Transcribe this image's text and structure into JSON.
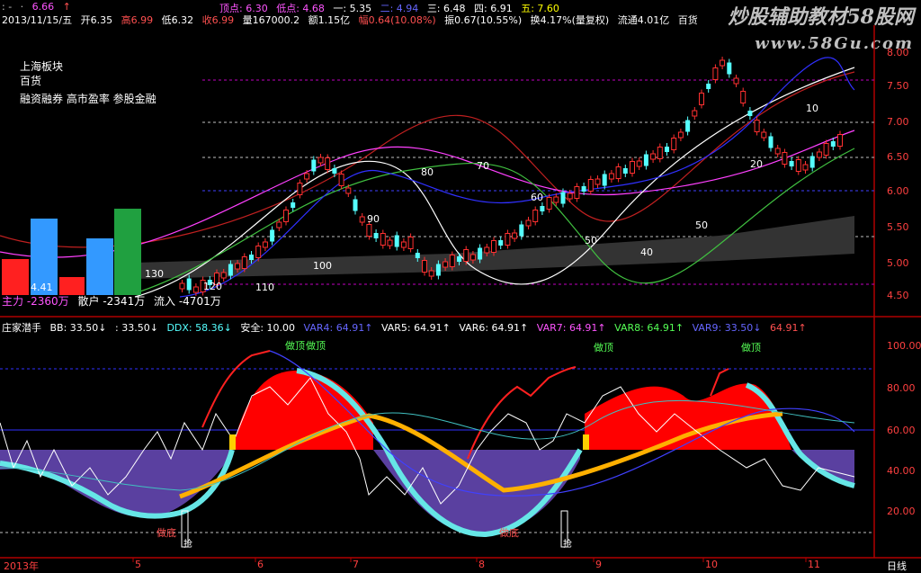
{
  "top_bar": {
    "row1_value": "6.66",
    "row1_arrow": "↑"
  },
  "quote": {
    "date": "2013/11/15/五",
    "open": "开6.35",
    "high": "高6.99",
    "low": "低6.32",
    "close": "收6.99",
    "volume": "量167000.2",
    "amount": "额1.15亿",
    "change": "幅0.64(10.08%)",
    "amplitude": "振0.67(10.55%)",
    "turnover": "换4.17%(量复权)",
    "float": "流通4.01亿",
    "sector": "百货"
  },
  "levels": {
    "top": "顶点: 6.30",
    "bottom": "低点: 4.68",
    "l1": "一: 5.35",
    "l2": "二: 4.94",
    "l3": "三: 6.48",
    "l4": "四: 6.91",
    "l5": "五: 7.60"
  },
  "watermark": {
    "title": "炒股辅助教材58股网",
    "url": "www.58Gu.com"
  },
  "info_panel": {
    "line1": "上海板块",
    "line2": "百货",
    "line3": "融资融券 高市盈率 参股金融"
  },
  "price_axis": [
    "7.50",
    "7.00",
    "6.50",
    "6.00",
    "5.50",
    "5.00",
    "4.50"
  ],
  "price_axis_extra": "8.00",
  "chart_labels": {
    "l130": "130",
    "l120": "120",
    "l110": "110",
    "l100": "100",
    "l90": "90",
    "l80": "80",
    "l70": "70",
    "l60": "60",
    "l50a": "50",
    "l50b": "50",
    "l40": "40",
    "l20": "20",
    "l10": "10",
    "l410": "4.41"
  },
  "flow": {
    "main": "主力 -2360万",
    "retail": "散户 -2341万",
    "inflow": "流入 -4701万"
  },
  "indicator_bar": {
    "name": "庄家潜手",
    "bb": "BB: 33.50↓",
    "bb2": ": 33.50↓",
    "ddx": "DDX: 58.36↓",
    "safe": "安全: 10.00",
    "var4": "VAR4: 64.91↑",
    "var5": "VAR5: 64.91↑",
    "var6": "VAR6: 64.91↑",
    "var7": "VAR7: 64.91↑",
    "var8": "VAR8: 64.91↑",
    "var9": "VAR9: 33.50↓",
    "last": "64.91↑"
  },
  "indicator_axis": [
    "100.00",
    "80.00",
    "60.00",
    "40.00",
    "20.00"
  ],
  "signals": {
    "top1": "做顶",
    "top2": "做顶",
    "top3": "做顶",
    "top4": "做顶",
    "bottom1": "做底",
    "bottom2": "做底",
    "check1": "抢",
    "check2": "抢"
  },
  "time_axis": {
    "year": "2013年",
    "m5": "5",
    "m6": "6",
    "m7": "7",
    "m8": "8",
    "m9": "9",
    "m10": "10",
    "m11": "11",
    "period": "日线"
  },
  "colors": {
    "up": "#ff3030",
    "down": "#55ffff",
    "accent": "#ff2020",
    "fill_red": "#ff0000",
    "fill_purple": "#5a40a0",
    "orange": "#ffb000"
  }
}
